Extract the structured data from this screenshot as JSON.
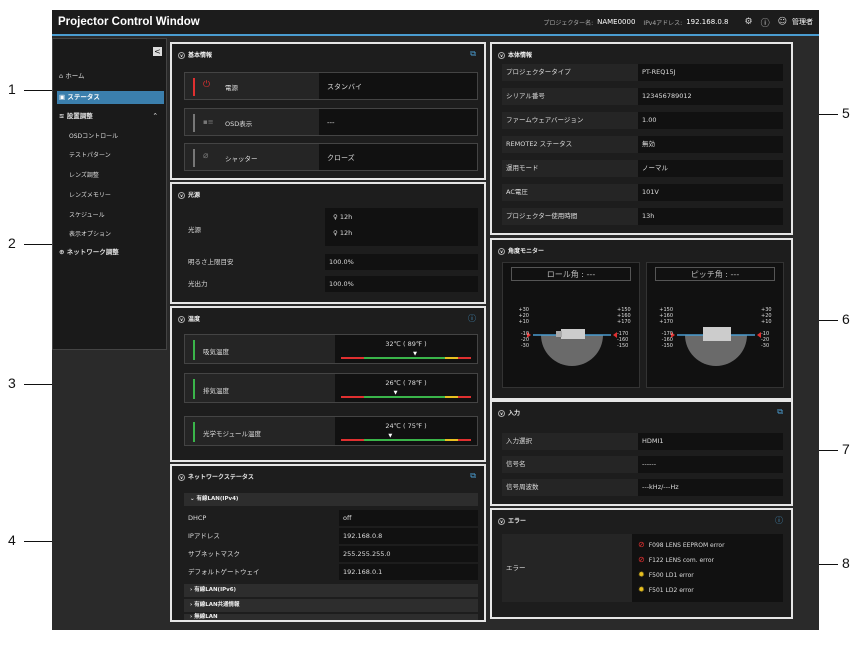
{
  "app": {
    "title": "Projector Control Window"
  },
  "topbar": {
    "projector_name_label": "プロジェクター名:",
    "projector_name": "NAME0000",
    "ipv4_label": "IPv4アドレス:",
    "ipv4": "192.168.0.8",
    "user": "管理者"
  },
  "sidebar": {
    "collapse": "<",
    "items": [
      {
        "label": "ホーム"
      },
      {
        "label": "ステータス"
      },
      {
        "label": "設置調整"
      },
      {
        "label": "OSDコントロール"
      },
      {
        "label": "テストパターン"
      },
      {
        "label": "レンズ調整"
      },
      {
        "label": "レンズメモリー"
      },
      {
        "label": "スケジュール"
      },
      {
        "label": "表示オプション"
      },
      {
        "label": "ネットワーク調整"
      }
    ]
  },
  "basic": {
    "title": "基本情報",
    "power_label": "電源",
    "power_value": "スタンバイ",
    "osd_label": "OSD表示",
    "osd_value": "---",
    "shutter_label": "シャッター",
    "shutter_value": "クローズ"
  },
  "light": {
    "title": "光源",
    "source_label": "光源",
    "hours1": "12h",
    "hours2": "12h",
    "brightness_label": "明るさ上限目安",
    "brightness_value": "100.0%",
    "output_label": "光出力",
    "output_value": "100.0%"
  },
  "temperature": {
    "title": "温度",
    "intake_label": "吸気温度",
    "intake_value": "32℃ ( 89℉ )",
    "intake_level": 0.57,
    "exhaust_label": "排気温度",
    "exhaust_value": "26℃ ( 78℉ )",
    "exhaust_level": 0.42,
    "optical_label": "光学モジュール温度",
    "optical_value": "24℃ ( 75℉ )",
    "optical_level": 0.38
  },
  "network": {
    "title": "ネットワークステータス",
    "ipv4_header": "有線LAN(IPv4)",
    "rows": [
      {
        "label": "DHCP",
        "value": "off"
      },
      {
        "label": "IPアドレス",
        "value": "192.168.0.8"
      },
      {
        "label": "サブネットマスク",
        "value": "255.255.255.0"
      },
      {
        "label": "デフォルトゲートウェイ",
        "value": "192.168.0.1"
      }
    ],
    "ipv6_header": "有線LAN(IPv6)",
    "common_header": "有線LAN共通情報",
    "wireless_header": "無線LAN"
  },
  "device": {
    "title": "本体情報",
    "rows": [
      {
        "label": "プロジェクタータイプ",
        "value": "PT-REQ15J"
      },
      {
        "label": "シリアル番号",
        "value": "123456789012"
      },
      {
        "label": "ファームウェアバージョン",
        "value": "1.00"
      },
      {
        "label": "REMOTE2 ステータス",
        "value": "無効"
      },
      {
        "label": "運用モード",
        "value": "ノーマル"
      },
      {
        "label": "AC電圧",
        "value": "101V"
      },
      {
        "label": "プロジェクター使用時間",
        "value": "13h"
      }
    ]
  },
  "angle": {
    "title": "角度モニター",
    "roll_title": "ロール角 : ---",
    "pitch_title": "ピッチ角 : ---",
    "roll_left": [
      "+30",
      "+20",
      "+10",
      "0",
      "-10",
      "-20",
      "-30"
    ],
    "roll_right": [
      "+150",
      "+160",
      "+170",
      "180",
      "-170",
      "-160",
      "-150"
    ],
    "pitch_left": [
      "+150",
      "+160",
      "+170",
      "180",
      "-170",
      "-160",
      "-150"
    ],
    "pitch_right": [
      "+30",
      "+20",
      "+10",
      "0",
      "-10",
      "-20",
      "-30"
    ]
  },
  "input": {
    "title": "入力",
    "rows": [
      {
        "label": "入力選択",
        "value": "HDMI1"
      },
      {
        "label": "信号名",
        "value": "------"
      },
      {
        "label": "信号周波数",
        "value": "---kHz/---Hz"
      }
    ]
  },
  "errors": {
    "title": "エラー",
    "label": "エラー",
    "items": [
      {
        "text": "F098 LENS EEPROM error",
        "kind": "error"
      },
      {
        "text": "F122 LENS com. error",
        "kind": "error"
      },
      {
        "text": "F500 LD1 error",
        "kind": "warning"
      },
      {
        "text": "F501 LD2 error",
        "kind": "warning"
      }
    ]
  },
  "callouts": [
    "1",
    "2",
    "3",
    "4",
    "5",
    "6",
    "7",
    "8"
  ],
  "colors": {
    "accent": "#4a9cd0",
    "power": "#e03030",
    "ok": "#3ab54a",
    "warn": "#e8c020",
    "err": "#e03030"
  }
}
